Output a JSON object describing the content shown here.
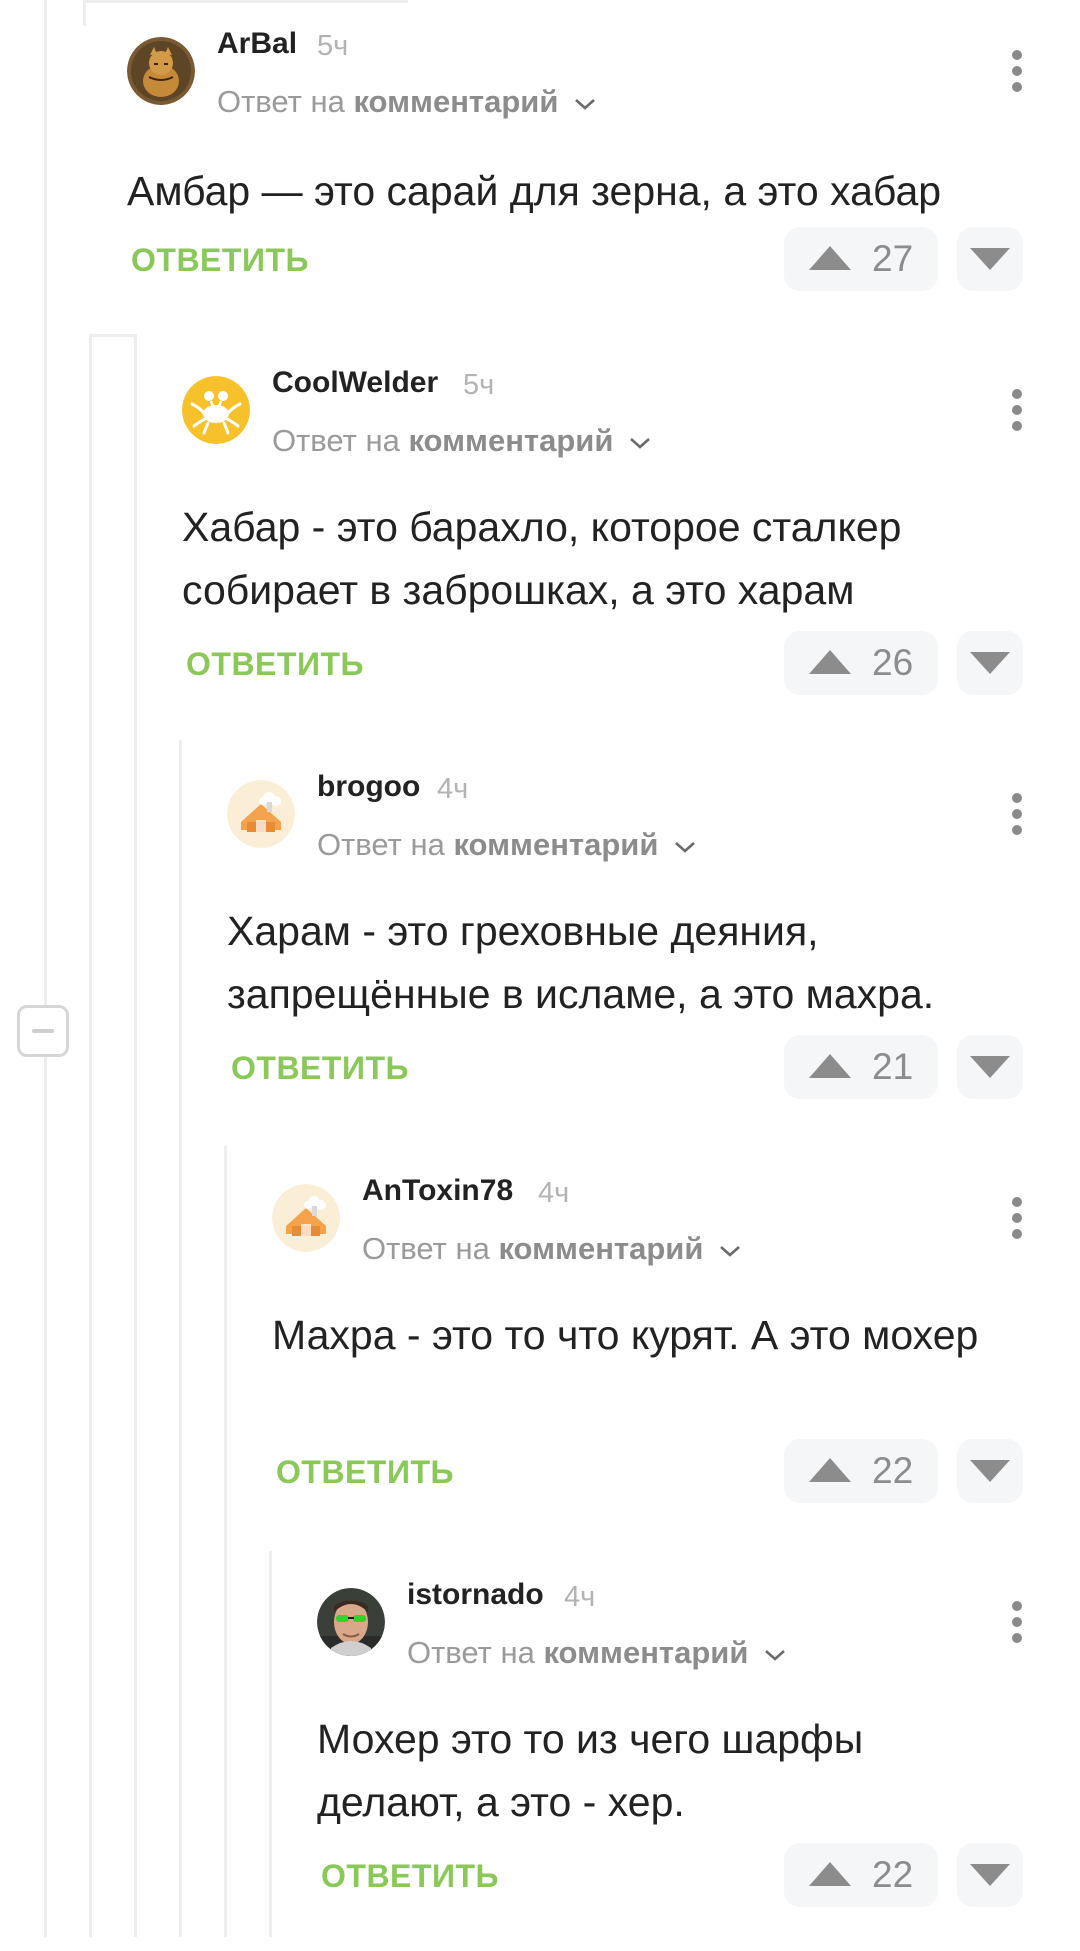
{
  "labels": {
    "reply_to_prefix": "Ответ на",
    "reply_to_target": "комментарий",
    "reply_action": "ОТВЕТИТЬ"
  },
  "colors": {
    "accent_green": "#8ac858",
    "text": "#222222",
    "muted": "#9a9a9a",
    "vote_bg": "#f5f6f8"
  },
  "icons": {
    "more": "vertical-ellipsis",
    "upvote": "triangle-up",
    "downvote": "triangle-down",
    "collapse": "minus-square",
    "chevron": "chevron-down"
  },
  "comments": [
    {
      "author": "ArBal",
      "time": "5ч",
      "text": "Амбар — это сарай для зерна, а это хабар",
      "rating": "27",
      "avatar": "cat-photo"
    },
    {
      "author": "CoolWelder",
      "time": "5ч",
      "text": "Хабар - это барахло, которое сталкер собирает в заброшках, а это харам",
      "rating": "26",
      "avatar": "yellow-monster"
    },
    {
      "author": "brogoo",
      "time": "4ч",
      "text": "Харам - это греховные деяния, запрещённые в исламе, а это махра.",
      "rating": "21",
      "avatar": "default-house"
    },
    {
      "author": "AnToxin78",
      "time": "4ч",
      "text": "Махра - это то что курят. А это мохер",
      "rating": "22",
      "avatar": "default-house"
    },
    {
      "author": "istornado",
      "time": "4ч",
      "text": "Мохер это то из чего шарфы делают, а это - хер.",
      "rating": "22",
      "avatar": "man-sunglasses"
    }
  ]
}
